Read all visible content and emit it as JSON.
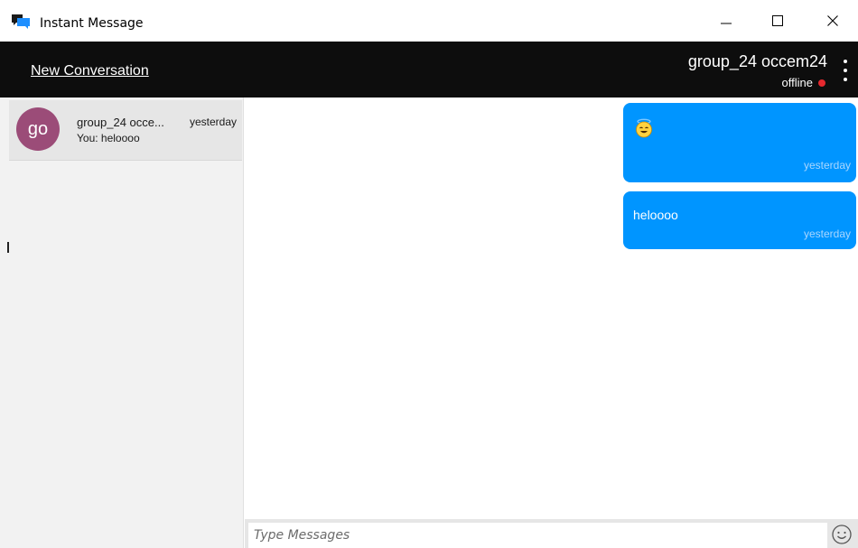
{
  "window": {
    "title": "Instant Message",
    "icon": "chat-bubbles-icon",
    "controls": [
      "minimize-icon",
      "maximize-icon",
      "close-icon"
    ]
  },
  "header": {
    "new_conversation_label": "New Conversation",
    "contact_name": "group_24 occem24",
    "contact_status": "offline",
    "status_color": "#e5282e",
    "menu_icon": "more-vertical-icon"
  },
  "sidebar": {
    "conversations": [
      {
        "avatar_initials": "go",
        "avatar_color": "#9b4c78",
        "name": "group_24 occe...",
        "time": "yesterday",
        "preview": "You: heloooo"
      }
    ]
  },
  "messages": [
    {
      "type": "emoji",
      "emoji_icon": "smiling-face-with-halo-icon",
      "time": "yesterday"
    },
    {
      "type": "text",
      "text": "heloooo",
      "time": "yesterday"
    }
  ],
  "composer": {
    "placeholder": "Type Messages",
    "emoji_button_icon": "smiley-icon"
  },
  "colors": {
    "header_bg": "#0d0d0d",
    "bubble_bg": "#0095ff",
    "sidebar_bg": "#f2f2f2",
    "selected_item_bg": "#e6e6e6"
  }
}
